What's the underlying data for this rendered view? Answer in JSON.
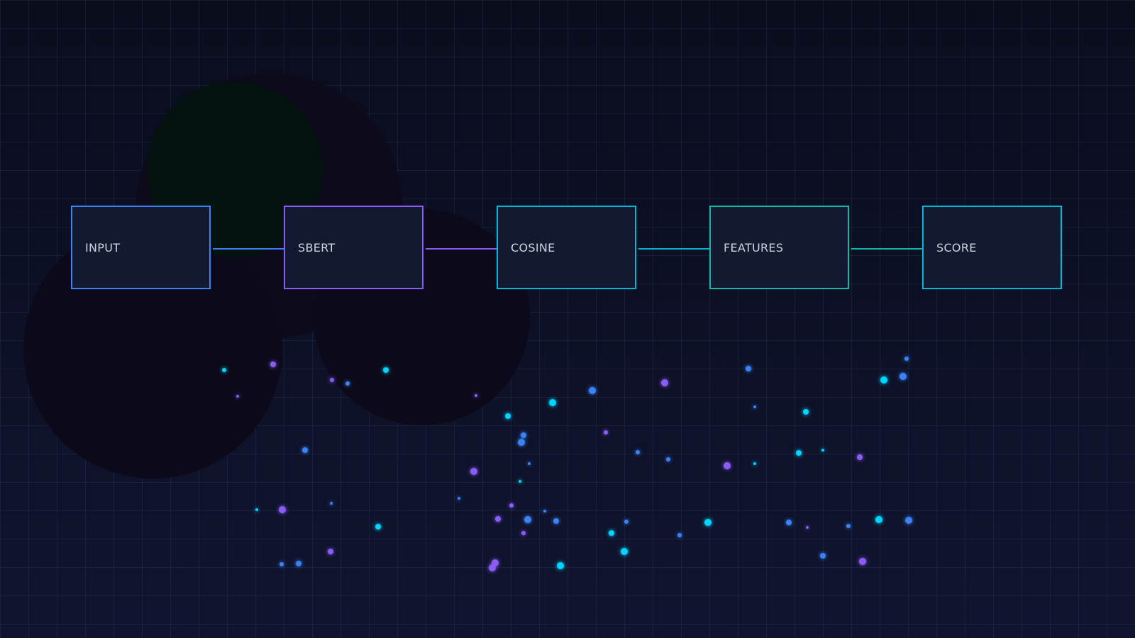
{
  "pipeline": {
    "nodes": [
      {
        "label": "INPUT",
        "color": "#3b82f6"
      },
      {
        "label": "SBERT",
        "color": "#8b5cf6"
      },
      {
        "label": "COSINE",
        "color": "#06b6d4"
      },
      {
        "label": "FEATURES",
        "color": "#14b8a6"
      },
      {
        "label": "SCORE",
        "color": "#06b6d4"
      }
    ],
    "connector_colors": [
      "#3b82f6",
      "#8b5cf6",
      "#06b6d4",
      "#14b8a6"
    ]
  },
  "palette": {
    "background": "#0b0f22",
    "grid": "#1e2a44",
    "node_fill": "#111a30",
    "label_text": "#cbd5e1",
    "particle_cyan": "#00d4ff",
    "particle_blue": "#3b82f6",
    "particle_purple": "#8b5cf6"
  }
}
